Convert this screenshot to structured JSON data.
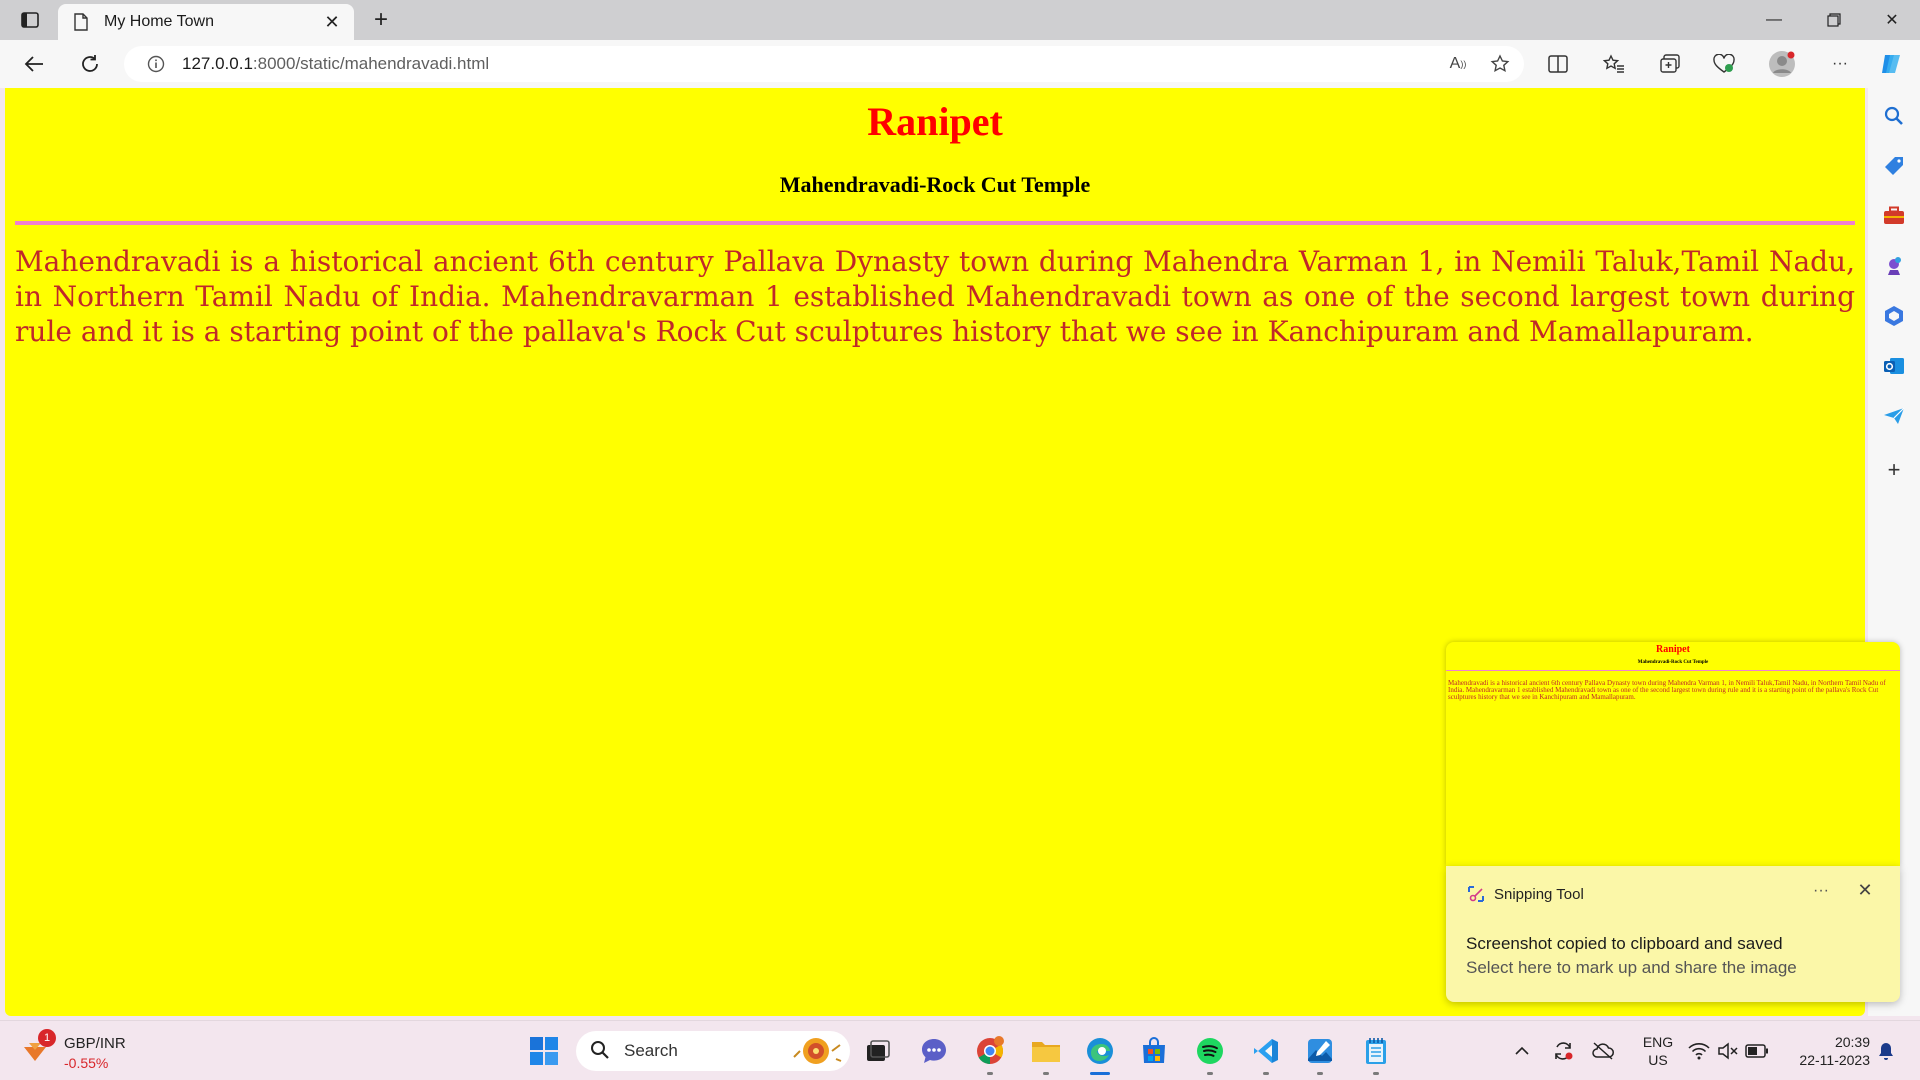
{
  "browser": {
    "tab_title": "My Home Town",
    "url_host": "127.0.0.1",
    "url_rest": ":8000/static/mahendravadi.html"
  },
  "page": {
    "heading": "Ranipet",
    "subheading": "Mahendravadi-Rock Cut Temple",
    "paragraph": "Mahendravadi is a historical ancient 6th century Pallava Dynasty town during Mahendra Varman 1, in Nemili Taluk,Tamil Nadu, in Northern Tamil Nadu of India. Mahendravarman 1 established Mahendravadi town as one of the second largest town during rule and it is a starting point of the pallava's Rock Cut sculptures history that we see in Kanchipuram and Mamallapuram.",
    "background_color": "#ffff00",
    "heading_color": "#ff0000",
    "text_color": "#c0282a",
    "rule_color": "#f080d0"
  },
  "toast": {
    "app_name": "Snipping Tool",
    "more_label": "···",
    "heading": "Screenshot copied to clipboard and saved",
    "body": "Select here to mark up and share the image"
  },
  "taskbar": {
    "widget_badge": "1",
    "widget_name": "GBP/INR",
    "widget_value": "-0.55%",
    "search_label": "Search",
    "lang_line1": "ENG",
    "lang_line2": "US",
    "time": "20:39",
    "date": "22-11-2023"
  }
}
